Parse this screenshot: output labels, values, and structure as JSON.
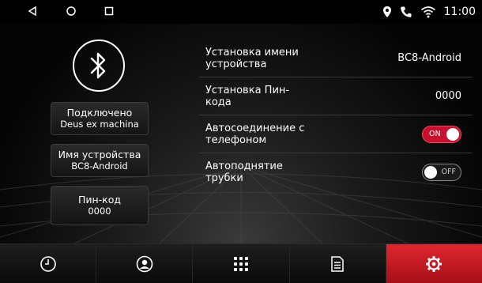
{
  "status_bar": {
    "time": "11:00",
    "icons": [
      "back-icon",
      "home-icon",
      "recents-icon",
      "location-icon",
      "phone-icon",
      "wifi-icon"
    ]
  },
  "left_panel": {
    "bluetooth_icon": "bluetooth-icon",
    "connected": {
      "title": "Подключено",
      "value": "Deus ex machina"
    },
    "device_name": {
      "title": "Имя устройства",
      "value": "BC8-Android"
    },
    "pin_code": {
      "title": "Пин-код",
      "value": "0000"
    }
  },
  "settings": {
    "device_name_row": {
      "label": "Установка имени\nустройства",
      "value": "BC8-Android"
    },
    "pin_row": {
      "label": "Установка Пин-\nкода",
      "value": "0000"
    },
    "auto_connect_row": {
      "label": "Автосоединение с\nтелефоном",
      "toggle_text": "ON",
      "state": true
    },
    "auto_answer_row": {
      "label": "Автоподнятие\nтрубки",
      "toggle_text": "OFF",
      "state": false
    }
  },
  "bottom_nav": {
    "tabs": [
      {
        "icon": "clock-icon",
        "active": false
      },
      {
        "icon": "contact-icon",
        "active": false
      },
      {
        "icon": "dialpad-icon",
        "active": false
      },
      {
        "icon": "call-log-icon",
        "active": false
      },
      {
        "icon": "settings-icon",
        "active": true
      }
    ]
  },
  "colors": {
    "accent": "#c8102e",
    "background": "#000000"
  }
}
